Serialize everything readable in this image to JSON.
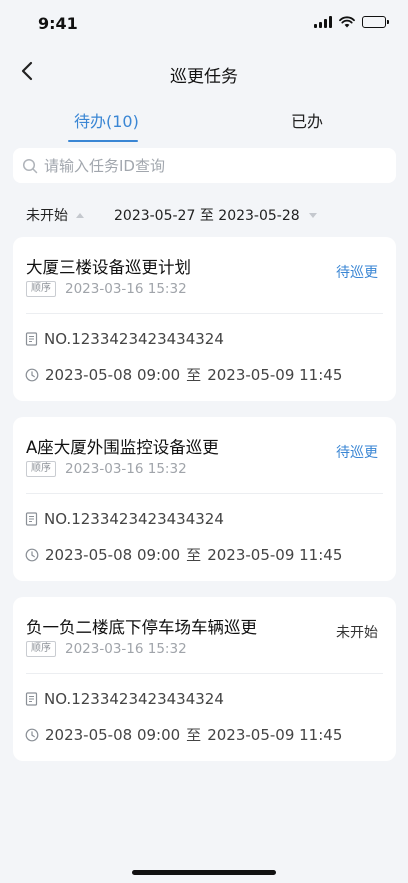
{
  "status_bar": {
    "time": "9:41"
  },
  "nav": {
    "title": "巡更任务"
  },
  "tabs": [
    {
      "label": "待办(10)",
      "active": true
    },
    {
      "label": "已办",
      "active": false
    }
  ],
  "search": {
    "placeholder": "请输入任务ID查询",
    "value": ""
  },
  "filter": {
    "status": "未开始",
    "start_date": "2023-05-27",
    "range_sep": "至",
    "end_date": "2023-05-28"
  },
  "cards": [
    {
      "title": "大厦三楼设备巡更计划",
      "state": "待巡更",
      "tag": "顺序",
      "created": "2023-03-16 15:32",
      "no": "NO.1233423423434324",
      "start": "2023-05-08 09:00",
      "sep": "至",
      "end": "2023-05-09 11:45"
    },
    {
      "title": "A座大厦外围监控设备巡更",
      "state": "待巡更",
      "tag": "顺序",
      "created": "2023-03-16 15:32",
      "no": "NO.1233423423434324",
      "start": "2023-05-08 09:00",
      "sep": "至",
      "end": "2023-05-09 11:45"
    },
    {
      "title": "负一负二楼底下停车场车辆巡更",
      "state": "未开始",
      "tag": "顺序",
      "created": "2023-03-16 15:32",
      "no": "NO.1233423423434324",
      "start": "2023-05-08 09:00",
      "sep": "至",
      "end": "2023-05-09 11:45"
    }
  ],
  "colors": {
    "accent": "#3a86d4",
    "background": "#f3f5f8"
  }
}
